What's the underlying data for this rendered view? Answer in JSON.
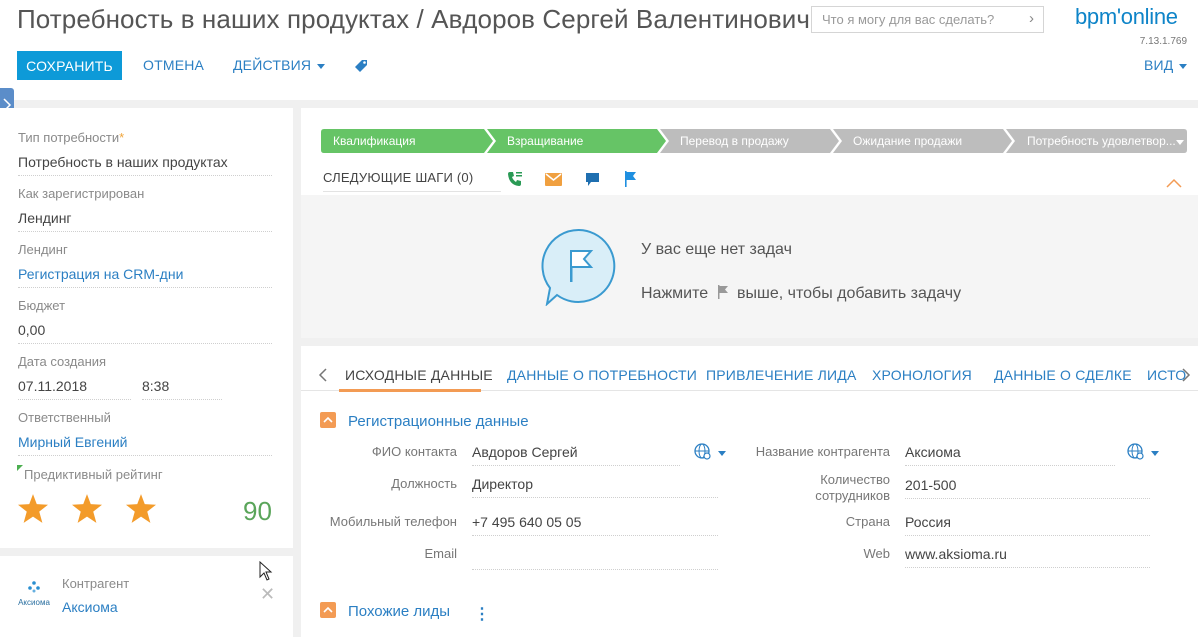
{
  "header": {
    "title": "Потребность в наших продуктах / Авдоров Сергей Валентинович,...",
    "search_placeholder": "Что я могу для вас сделать?",
    "logo": "bpm'online",
    "version": "7.13.1.769"
  },
  "toolbar": {
    "save_label": "СОХРАНИТЬ",
    "cancel_label": "ОТМЕНА",
    "actions_label": "ДЕЙСТВИЯ",
    "view_label": "ВИД"
  },
  "left_fields": [
    {
      "caption": "Тип потребности",
      "required": "*",
      "value": "Потребность в наших продуктах",
      "link": false
    },
    {
      "caption": "Как зарегистрирован",
      "value": "Лендинг",
      "link": false
    },
    {
      "caption": "Лендинг",
      "value": "Регистрация на CRM-дни",
      "link": true
    },
    {
      "caption": "Бюджет",
      "value": "0,00",
      "link": false
    },
    {
      "caption": "Дата создания",
      "value": "07.11.2018",
      "time": "8:38",
      "link": false
    },
    {
      "caption": "Ответственный",
      "value": "Мирный Евгений",
      "link": true
    }
  ],
  "predictive": {
    "caption": "Предиктивный рейтинг",
    "stars": 3,
    "value": "90"
  },
  "account_card": {
    "caption": "Контрагент",
    "value": "Аксиома",
    "logo_text": "Аксиома"
  },
  "stages": [
    {
      "label": "Квалификация",
      "state": "done"
    },
    {
      "label": "Взращивание",
      "state": "done"
    },
    {
      "label": "Перевод в продажу",
      "state": "pending"
    },
    {
      "label": "Ожидание продажи",
      "state": "pending"
    },
    {
      "label": "Потребность удовлетвор...",
      "state": "pending"
    }
  ],
  "next_steps": {
    "label": "СЛЕДУЮЩИЕ ШАГИ (0)",
    "empty_title": "У вас еще нет задач",
    "hint_before": "Нажмите",
    "hint_after": "выше, чтобы добавить задачу"
  },
  "tabs": [
    {
      "label": "ИСХОДНЫЕ ДАННЫЕ",
      "active": true
    },
    {
      "label": "ДАННЫЕ О ПОТРЕБНОСТИ"
    },
    {
      "label": "ПРИВЛЕЧЕНИЕ ЛИДА"
    },
    {
      "label": "ХРОНОЛОГИЯ"
    },
    {
      "label": "ДАННЫЕ О СДЕЛКЕ"
    },
    {
      "label": "ИСТО"
    }
  ],
  "registration": {
    "title": "Регистрационные данные",
    "contact_label": "ФИО контакта",
    "contact_value": "Авдоров Сергей",
    "position_label": "Должность",
    "position_value": "Директор",
    "mobile_label": "Мобильный телефон",
    "mobile_value": "+7 495 640 05 05",
    "email_label": "Email",
    "email_value": "",
    "account_label": "Название контрагента",
    "account_value": "Аксиома",
    "employees_label_1": "Количество",
    "employees_label_2": "сотрудников",
    "employees_value": "201-500",
    "country_label": "Страна",
    "country_value": "Россия",
    "web_label": "Web",
    "web_value": "www.aksioma.ru"
  },
  "similar": {
    "title": "Похожие лиды"
  },
  "colors": {
    "accent": "#0d9ad8",
    "link": "#2b7fc3",
    "stage_done": "#66c466",
    "stage_pending": "#bdbdbd",
    "orange": "#f39b54"
  }
}
